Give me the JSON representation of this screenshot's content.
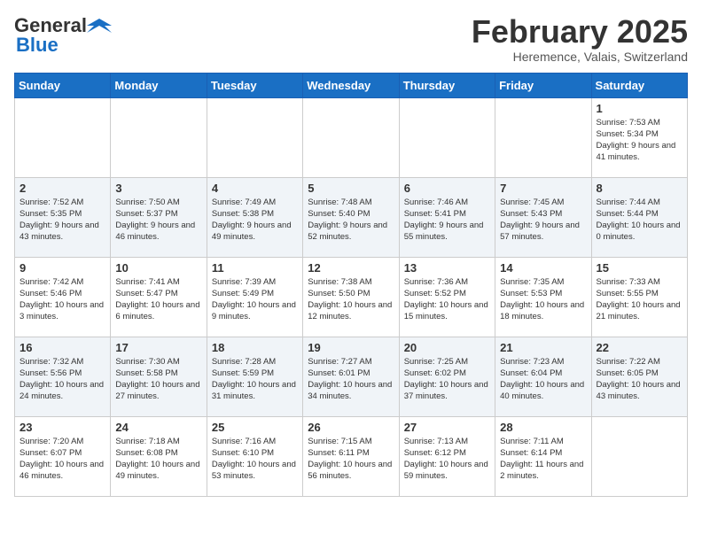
{
  "header": {
    "logo_general": "General",
    "logo_blue": "Blue",
    "month_title": "February 2025",
    "location": "Heremence, Valais, Switzerland"
  },
  "weekdays": [
    "Sunday",
    "Monday",
    "Tuesday",
    "Wednesday",
    "Thursday",
    "Friday",
    "Saturday"
  ],
  "weeks": [
    [
      {
        "day": "",
        "info": ""
      },
      {
        "day": "",
        "info": ""
      },
      {
        "day": "",
        "info": ""
      },
      {
        "day": "",
        "info": ""
      },
      {
        "day": "",
        "info": ""
      },
      {
        "day": "",
        "info": ""
      },
      {
        "day": "1",
        "info": "Sunrise: 7:53 AM\nSunset: 5:34 PM\nDaylight: 9 hours and 41 minutes."
      }
    ],
    [
      {
        "day": "2",
        "info": "Sunrise: 7:52 AM\nSunset: 5:35 PM\nDaylight: 9 hours and 43 minutes."
      },
      {
        "day": "3",
        "info": "Sunrise: 7:50 AM\nSunset: 5:37 PM\nDaylight: 9 hours and 46 minutes."
      },
      {
        "day": "4",
        "info": "Sunrise: 7:49 AM\nSunset: 5:38 PM\nDaylight: 9 hours and 49 minutes."
      },
      {
        "day": "5",
        "info": "Sunrise: 7:48 AM\nSunset: 5:40 PM\nDaylight: 9 hours and 52 minutes."
      },
      {
        "day": "6",
        "info": "Sunrise: 7:46 AM\nSunset: 5:41 PM\nDaylight: 9 hours and 55 minutes."
      },
      {
        "day": "7",
        "info": "Sunrise: 7:45 AM\nSunset: 5:43 PM\nDaylight: 9 hours and 57 minutes."
      },
      {
        "day": "8",
        "info": "Sunrise: 7:44 AM\nSunset: 5:44 PM\nDaylight: 10 hours and 0 minutes."
      }
    ],
    [
      {
        "day": "9",
        "info": "Sunrise: 7:42 AM\nSunset: 5:46 PM\nDaylight: 10 hours and 3 minutes."
      },
      {
        "day": "10",
        "info": "Sunrise: 7:41 AM\nSunset: 5:47 PM\nDaylight: 10 hours and 6 minutes."
      },
      {
        "day": "11",
        "info": "Sunrise: 7:39 AM\nSunset: 5:49 PM\nDaylight: 10 hours and 9 minutes."
      },
      {
        "day": "12",
        "info": "Sunrise: 7:38 AM\nSunset: 5:50 PM\nDaylight: 10 hours and 12 minutes."
      },
      {
        "day": "13",
        "info": "Sunrise: 7:36 AM\nSunset: 5:52 PM\nDaylight: 10 hours and 15 minutes."
      },
      {
        "day": "14",
        "info": "Sunrise: 7:35 AM\nSunset: 5:53 PM\nDaylight: 10 hours and 18 minutes."
      },
      {
        "day": "15",
        "info": "Sunrise: 7:33 AM\nSunset: 5:55 PM\nDaylight: 10 hours and 21 minutes."
      }
    ],
    [
      {
        "day": "16",
        "info": "Sunrise: 7:32 AM\nSunset: 5:56 PM\nDaylight: 10 hours and 24 minutes."
      },
      {
        "day": "17",
        "info": "Sunrise: 7:30 AM\nSunset: 5:58 PM\nDaylight: 10 hours and 27 minutes."
      },
      {
        "day": "18",
        "info": "Sunrise: 7:28 AM\nSunset: 5:59 PM\nDaylight: 10 hours and 31 minutes."
      },
      {
        "day": "19",
        "info": "Sunrise: 7:27 AM\nSunset: 6:01 PM\nDaylight: 10 hours and 34 minutes."
      },
      {
        "day": "20",
        "info": "Sunrise: 7:25 AM\nSunset: 6:02 PM\nDaylight: 10 hours and 37 minutes."
      },
      {
        "day": "21",
        "info": "Sunrise: 7:23 AM\nSunset: 6:04 PM\nDaylight: 10 hours and 40 minutes."
      },
      {
        "day": "22",
        "info": "Sunrise: 7:22 AM\nSunset: 6:05 PM\nDaylight: 10 hours and 43 minutes."
      }
    ],
    [
      {
        "day": "23",
        "info": "Sunrise: 7:20 AM\nSunset: 6:07 PM\nDaylight: 10 hours and 46 minutes."
      },
      {
        "day": "24",
        "info": "Sunrise: 7:18 AM\nSunset: 6:08 PM\nDaylight: 10 hours and 49 minutes."
      },
      {
        "day": "25",
        "info": "Sunrise: 7:16 AM\nSunset: 6:10 PM\nDaylight: 10 hours and 53 minutes."
      },
      {
        "day": "26",
        "info": "Sunrise: 7:15 AM\nSunset: 6:11 PM\nDaylight: 10 hours and 56 minutes."
      },
      {
        "day": "27",
        "info": "Sunrise: 7:13 AM\nSunset: 6:12 PM\nDaylight: 10 hours and 59 minutes."
      },
      {
        "day": "28",
        "info": "Sunrise: 7:11 AM\nSunset: 6:14 PM\nDaylight: 11 hours and 2 minutes."
      },
      {
        "day": "",
        "info": ""
      }
    ]
  ]
}
